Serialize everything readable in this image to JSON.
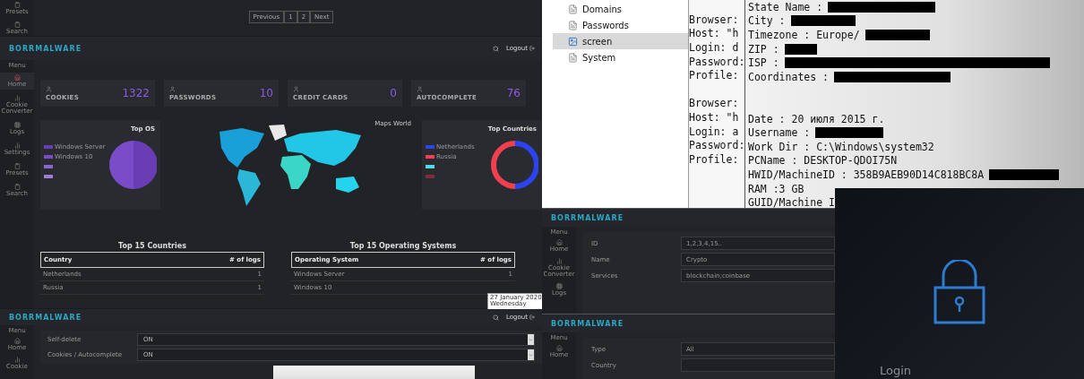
{
  "logs_strip": {
    "sidebar_items": [
      {
        "label": "Presets"
      },
      {
        "label": "Search"
      }
    ],
    "pagination": [
      "Previous",
      "1",
      "2",
      "Next"
    ]
  },
  "dashboard": {
    "brand": "BORRMALWARE",
    "logout": "Logout",
    "menu_label": "Menu",
    "sidebar_items": [
      {
        "label": "Home",
        "selected": true
      },
      {
        "label": "Cookie Converter",
        "selected": false
      },
      {
        "label": "Logs",
        "selected": false
      },
      {
        "label": "Settings",
        "selected": false
      },
      {
        "label": "Presets",
        "selected": false
      },
      {
        "label": "Search",
        "selected": false
      }
    ],
    "stats": [
      {
        "label": "COOKIES",
        "value": "1322"
      },
      {
        "label": "PASSWORDS",
        "value": "10"
      },
      {
        "label": "CREDIT CARDS",
        "value": "0"
      },
      {
        "label": "AUTOCOMPLETE",
        "value": "76"
      }
    ],
    "top_os": {
      "title": "Top OS",
      "legend": [
        {
          "label": "Windows Server",
          "color": "#6b3db5"
        },
        {
          "label": "Windows 10",
          "color": "#7a4cc8"
        },
        {
          "color": "#8b64d0"
        },
        {
          "color": "#9c7ed8"
        }
      ]
    },
    "map": {
      "title": "Maps World"
    },
    "top_countries": {
      "title": "Top Countries",
      "legend": [
        {
          "label": "Netherlands",
          "color": "#2b44f0"
        },
        {
          "label": "Russia",
          "color": "#f0404f"
        },
        {
          "color": "#4fdde0"
        },
        {
          "color": "#7a2d3a"
        }
      ]
    },
    "countries_table": {
      "title": "Top 15 Countries",
      "columns": [
        "Country",
        "# of logs"
      ],
      "rows": [
        [
          "Netherlands",
          "1"
        ],
        [
          "Russia",
          "1"
        ]
      ]
    },
    "os_table": {
      "title": "Top 15 Operating Systems",
      "columns": [
        "Operating System",
        "# of logs"
      ],
      "rows": [
        [
          "Windows Server",
          "1"
        ],
        [
          "Windows 10"
        ]
      ]
    },
    "tooltip": [
      "27 January 2020",
      "Wednesday"
    ]
  },
  "settings": {
    "brand": "BORRMALWARE",
    "logout": "Logout",
    "menu_label": "Menu",
    "sidebar_items": [
      {
        "label": "Home"
      },
      {
        "label": "Cookie"
      }
    ],
    "rows": [
      {
        "label": "Self-delete",
        "value": "ON"
      },
      {
        "label": "Cookies / Autocomplete",
        "value": "ON"
      }
    ]
  },
  "explorer": {
    "items": [
      {
        "label": "Domains",
        "kind": "document",
        "selected": false
      },
      {
        "label": "Passwords",
        "kind": "document",
        "selected": false
      },
      {
        "label": "screen",
        "kind": "image",
        "selected": true
      },
      {
        "label": "System",
        "kind": "document",
        "selected": false
      }
    ]
  },
  "notepad_back": {
    "lines": [
      {
        "kind": "text",
        "text": "Browser:"
      },
      {
        "kind": "text",
        "text": "Host: \"h"
      },
      {
        "kind": "text",
        "text": "Login: d"
      },
      {
        "kind": "text",
        "text": "Password:"
      },
      {
        "kind": "text",
        "text": "Profile:"
      },
      {
        "kind": "blank"
      },
      {
        "kind": "text",
        "text": "Browser:"
      },
      {
        "kind": "text",
        "text": "Host: \"h"
      },
      {
        "kind": "text",
        "text": "Login: a"
      },
      {
        "kind": "text",
        "text": "Password:"
      },
      {
        "kind": "text",
        "text": "Profile:"
      }
    ]
  },
  "notepad_front": {
    "lines": [
      {
        "kind": "redacted",
        "text": "State Name :"
      },
      {
        "kind": "redacted",
        "text": "City :"
      },
      {
        "kind": "redacted",
        "text": "Timezone : Europe/"
      },
      {
        "kind": "redacted",
        "text": "ZIP :"
      },
      {
        "kind": "redacted",
        "text": "ISP :"
      },
      {
        "kind": "redacted",
        "text": "Coordinates :"
      },
      {
        "kind": "blank"
      },
      {
        "kind": "blank"
      },
      {
        "kind": "text",
        "text": "Date : 20 июля 2015 г."
      },
      {
        "kind": "redacted",
        "text": "Username :"
      },
      {
        "kind": "text",
        "text": "Work Dir : C:\\Windows\\system32"
      },
      {
        "kind": "text",
        "text": "PCName : DESKTOP-QDOI75N"
      },
      {
        "kind": "redacted",
        "text": "HWID/MachineID : 358B9AEB90D14C818BC8A"
      },
      {
        "kind": "text",
        "text": "RAM :3 GB"
      },
      {
        "kind": "text",
        "text": "GUID/Machine I"
      }
    ]
  },
  "crypto_form": {
    "brand": "BORRMALWARE",
    "menu_label": "Menu",
    "sidebar_items": [
      {
        "label": "Home"
      },
      {
        "label": "Cookie Converter"
      },
      {
        "label": "Logs"
      }
    ],
    "fields": [
      {
        "label": "ID",
        "value": "1,2,3,4,15.."
      },
      {
        "label": "Name",
        "value": "Crypto"
      },
      {
        "label": "Services",
        "value": "blockchain;coinbase"
      }
    ]
  },
  "filter_form": {
    "brand": "BORRMALWARE",
    "menu_label": "Menu",
    "sidebar_items": [
      {
        "label": "Home"
      }
    ],
    "fields": [
      {
        "label": "Type",
        "value": "All"
      },
      {
        "label": "Country"
      }
    ]
  },
  "login": {
    "title": "Login"
  }
}
